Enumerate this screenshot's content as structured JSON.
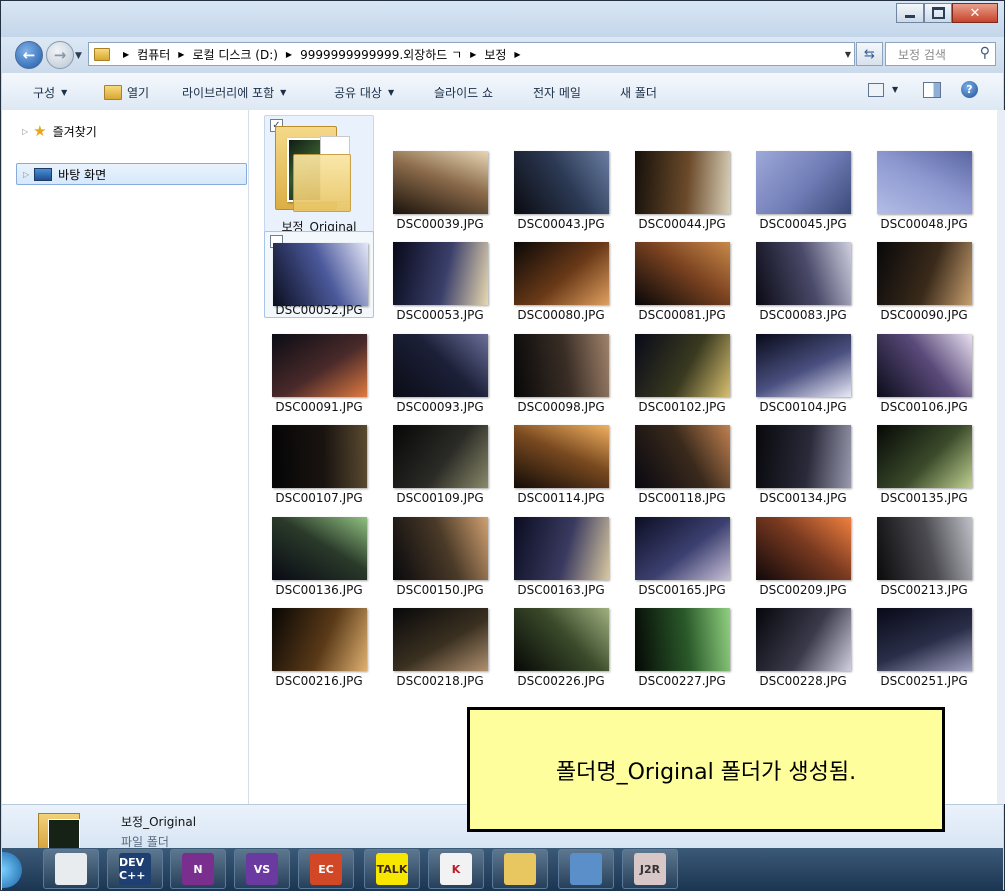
{
  "window": {
    "controls": [
      "minimize",
      "maximize",
      "close"
    ]
  },
  "address": {
    "crumbs": [
      "컴퓨터",
      "로컬 디스크 (D:)",
      "9999999999999.외장하드 ㄱ",
      "보정"
    ]
  },
  "search": {
    "placeholder": "보정 검색"
  },
  "toolbar": {
    "organize": "구성",
    "open": "열기",
    "include_library": "라이브러리에 포함",
    "share": "공유 대상",
    "slideshow": "슬라이드 쇼",
    "email": "전자 메일",
    "new_folder": "새 폴더"
  },
  "nav": {
    "favorites": "즐겨찾기",
    "desktop": "바탕 화면"
  },
  "folder": {
    "name": "보정_Original",
    "checked": true
  },
  "files": [
    {
      "name": "DSC00039.JPG",
      "colors": [
        "#1a120b",
        "#8a6a4a",
        "#e8d6b5"
      ]
    },
    {
      "name": "DSC00043.JPG",
      "colors": [
        "#0b0b10",
        "#2c3a55",
        "#6a7ea3"
      ]
    },
    {
      "name": "DSC00044.JPG",
      "colors": [
        "#15100a",
        "#6b4a2a",
        "#d9d0b8"
      ]
    },
    {
      "name": "DSC00045.JPG",
      "colors": [
        "#9da9d8",
        "#6f7bb5",
        "#3b4a78"
      ]
    },
    {
      "name": "DSC00048.JPG",
      "colors": [
        "#b3bde6",
        "#8c97cf",
        "#5a66a3"
      ]
    },
    {
      "name": "DSC00052.JPG",
      "colors": [
        "#0a0d1e",
        "#4c5a9c",
        "#e6e8f8"
      ]
    },
    {
      "name": "DSC00053.JPG",
      "colors": [
        "#08091a",
        "#3a3f6a",
        "#e8d8b0"
      ]
    },
    {
      "name": "DSC00080.JPG",
      "colors": [
        "#0a0806",
        "#6b3a18",
        "#e0a060"
      ]
    },
    {
      "name": "DSC00081.JPG",
      "colors": [
        "#060608",
        "#7a4220",
        "#c9894a"
      ]
    },
    {
      "name": "DSC00083.JPG",
      "colors": [
        "#0a0a14",
        "#4a4a6a",
        "#cfcfe0"
      ]
    },
    {
      "name": "DSC00090.JPG",
      "colors": [
        "#08080a",
        "#3a2a1a",
        "#c9a070"
      ]
    },
    {
      "name": "DSC00091.JPG",
      "colors": [
        "#0a0c14",
        "#4a2a2a",
        "#e07a40"
      ]
    },
    {
      "name": "DSC00093.JPG",
      "colors": [
        "#0b0c16",
        "#1c2038",
        "#6a6f9a"
      ]
    },
    {
      "name": "DSC00098.JPG",
      "colors": [
        "#070708",
        "#3a2e26",
        "#a0826a"
      ]
    },
    {
      "name": "DSC00102.JPG",
      "colors": [
        "#080a18",
        "#3a3a20",
        "#d8c070"
      ]
    },
    {
      "name": "DSC00104.JPG",
      "colors": [
        "#080a1a",
        "#4a5080",
        "#eaeaf8"
      ]
    },
    {
      "name": "DSC00106.JPG",
      "colors": [
        "#0a0c1a",
        "#5a4a7a",
        "#e8e0f0"
      ]
    },
    {
      "name": "DSC00107.JPG",
      "colors": [
        "#050506",
        "#1a1410",
        "#5a4a30"
      ]
    },
    {
      "name": "DSC00109.JPG",
      "colors": [
        "#070708",
        "#2a2a26",
        "#8a8a6a"
      ]
    },
    {
      "name": "DSC00114.JPG",
      "colors": [
        "#120c08",
        "#7a4a20",
        "#f0b060"
      ]
    },
    {
      "name": "DSC00118.JPG",
      "colors": [
        "#080810",
        "#3a2a1c",
        "#c08050"
      ]
    },
    {
      "name": "DSC00134.JPG",
      "colors": [
        "#08080c",
        "#2a2a3a",
        "#9a9ab0"
      ]
    },
    {
      "name": "DSC00135.JPG",
      "colors": [
        "#060806",
        "#3a4a2a",
        "#c0d090"
      ]
    },
    {
      "name": "DSC00136.JPG",
      "colors": [
        "#090a14",
        "#2a3a2a",
        "#90c080"
      ]
    },
    {
      "name": "DSC00150.JPG",
      "colors": [
        "#08080c",
        "#4a3a28",
        "#d0a070"
      ]
    },
    {
      "name": "DSC00163.JPG",
      "colors": [
        "#0a0c20",
        "#3a3a60",
        "#d8c8a0"
      ]
    },
    {
      "name": "DSC00165.JPG",
      "colors": [
        "#0c0e24",
        "#3c4070",
        "#c8c0d8"
      ]
    },
    {
      "name": "DSC00209.JPG",
      "colors": [
        "#10080a",
        "#7a3a20",
        "#f08040"
      ]
    },
    {
      "name": "DSC00213.JPG",
      "colors": [
        "#0a0a0c",
        "#4a4a50",
        "#c0c0c8"
      ]
    },
    {
      "name": "DSC00216.JPG",
      "colors": [
        "#080604",
        "#5a3a18",
        "#e0b070"
      ]
    },
    {
      "name": "DSC00218.JPG",
      "colors": [
        "#08080a",
        "#3a3020",
        "#b09070"
      ]
    },
    {
      "name": "DSC00226.JPG",
      "colors": [
        "#070806",
        "#3a4a2a",
        "#a0b080"
      ]
    },
    {
      "name": "DSC00227.JPG",
      "colors": [
        "#050805",
        "#2a5a2a",
        "#90d080"
      ]
    },
    {
      "name": "DSC00228.JPG",
      "colors": [
        "#06070c",
        "#3a3a4a",
        "#d0d0e0"
      ]
    },
    {
      "name": "DSC00251.JPG",
      "colors": [
        "#080a18",
        "#2a2e48",
        "#a0a0c0"
      ]
    }
  ],
  "details": {
    "name": "보정_Original",
    "type": "파일 폴더"
  },
  "taskbar": {
    "apps": [
      {
        "name": "snipping-tool",
        "label": ""
      },
      {
        "name": "dev-cpp",
        "label": "DEV C++"
      },
      {
        "name": "onenote",
        "label": "N"
      },
      {
        "name": "visual-studio",
        "label": "VS"
      },
      {
        "name": "powerpoint",
        "label": "EC"
      },
      {
        "name": "kakaotalk",
        "label": "TALK"
      },
      {
        "name": "kaspersky",
        "label": "K"
      },
      {
        "name": "file-explorer",
        "label": ""
      },
      {
        "name": "photo-viewer",
        "label": ""
      },
      {
        "name": "j2r",
        "label": "J2R"
      }
    ]
  },
  "callout": {
    "text": "폴더명_Original 폴더가 생성됨."
  }
}
